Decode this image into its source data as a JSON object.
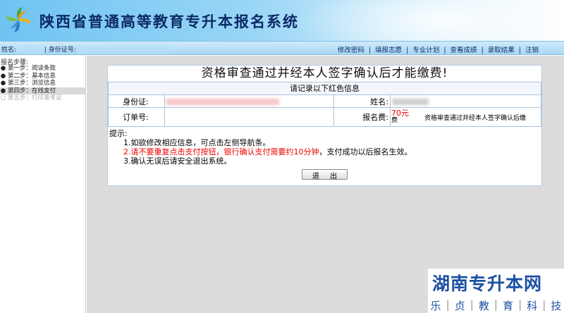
{
  "header": {
    "title": "陕西省普通高等教育专升本报名系统",
    "logo_icon": "pinwheel-logo-icon"
  },
  "navbar": {
    "name_label": "姓名:",
    "id_label": "| 身份证号:",
    "links": [
      "修改密码",
      "填报志愿",
      "专业计划",
      "查看成绩",
      "录取结果",
      "注销"
    ]
  },
  "sidebar": {
    "title": "报名步骤:",
    "steps": [
      {
        "label": "第一步：阅读条款",
        "marker": "●"
      },
      {
        "label": "第二步：基本信息",
        "marker": "●"
      },
      {
        "label": "第三步：浏览信息",
        "marker": "●"
      },
      {
        "label": "第四步：在线支付",
        "marker": "●"
      },
      {
        "label": "第五步：打印准考证",
        "marker": "○"
      }
    ]
  },
  "panel": {
    "title": "资格审查通过并经本人签字确认后才能缴费!",
    "note": "请记录以下红色信息",
    "id_label": "身份证:",
    "name_label": "姓名:",
    "order_label": "订单号:",
    "fee_label": "报名费:",
    "fee_value": "70元",
    "fee_unit": "费",
    "side_note": "资格审查通过并经本人签字确认后缴"
  },
  "tips": {
    "heading": "提示:",
    "line1": "1.如欲修改相应信息，可点击左侧导航条。",
    "line2_red": "2.请不要重复点击支付按钮，银行确认支付需要约10分钟",
    "line2_rest": "，支付成功以后报名生效。",
    "line3": "3.确认无误后请安全退出系统。"
  },
  "exit_button": "退 出",
  "watermark": {
    "title": "湖南专升本网",
    "sub": [
      "乐",
      "贞",
      "教",
      "育",
      "科",
      "技"
    ]
  },
  "colors": {
    "header_blue": "#6fc3f2",
    "title_navy": "#0d2a66",
    "warning_red": "#e00000",
    "watermark_blue": "#1c4fa3"
  }
}
